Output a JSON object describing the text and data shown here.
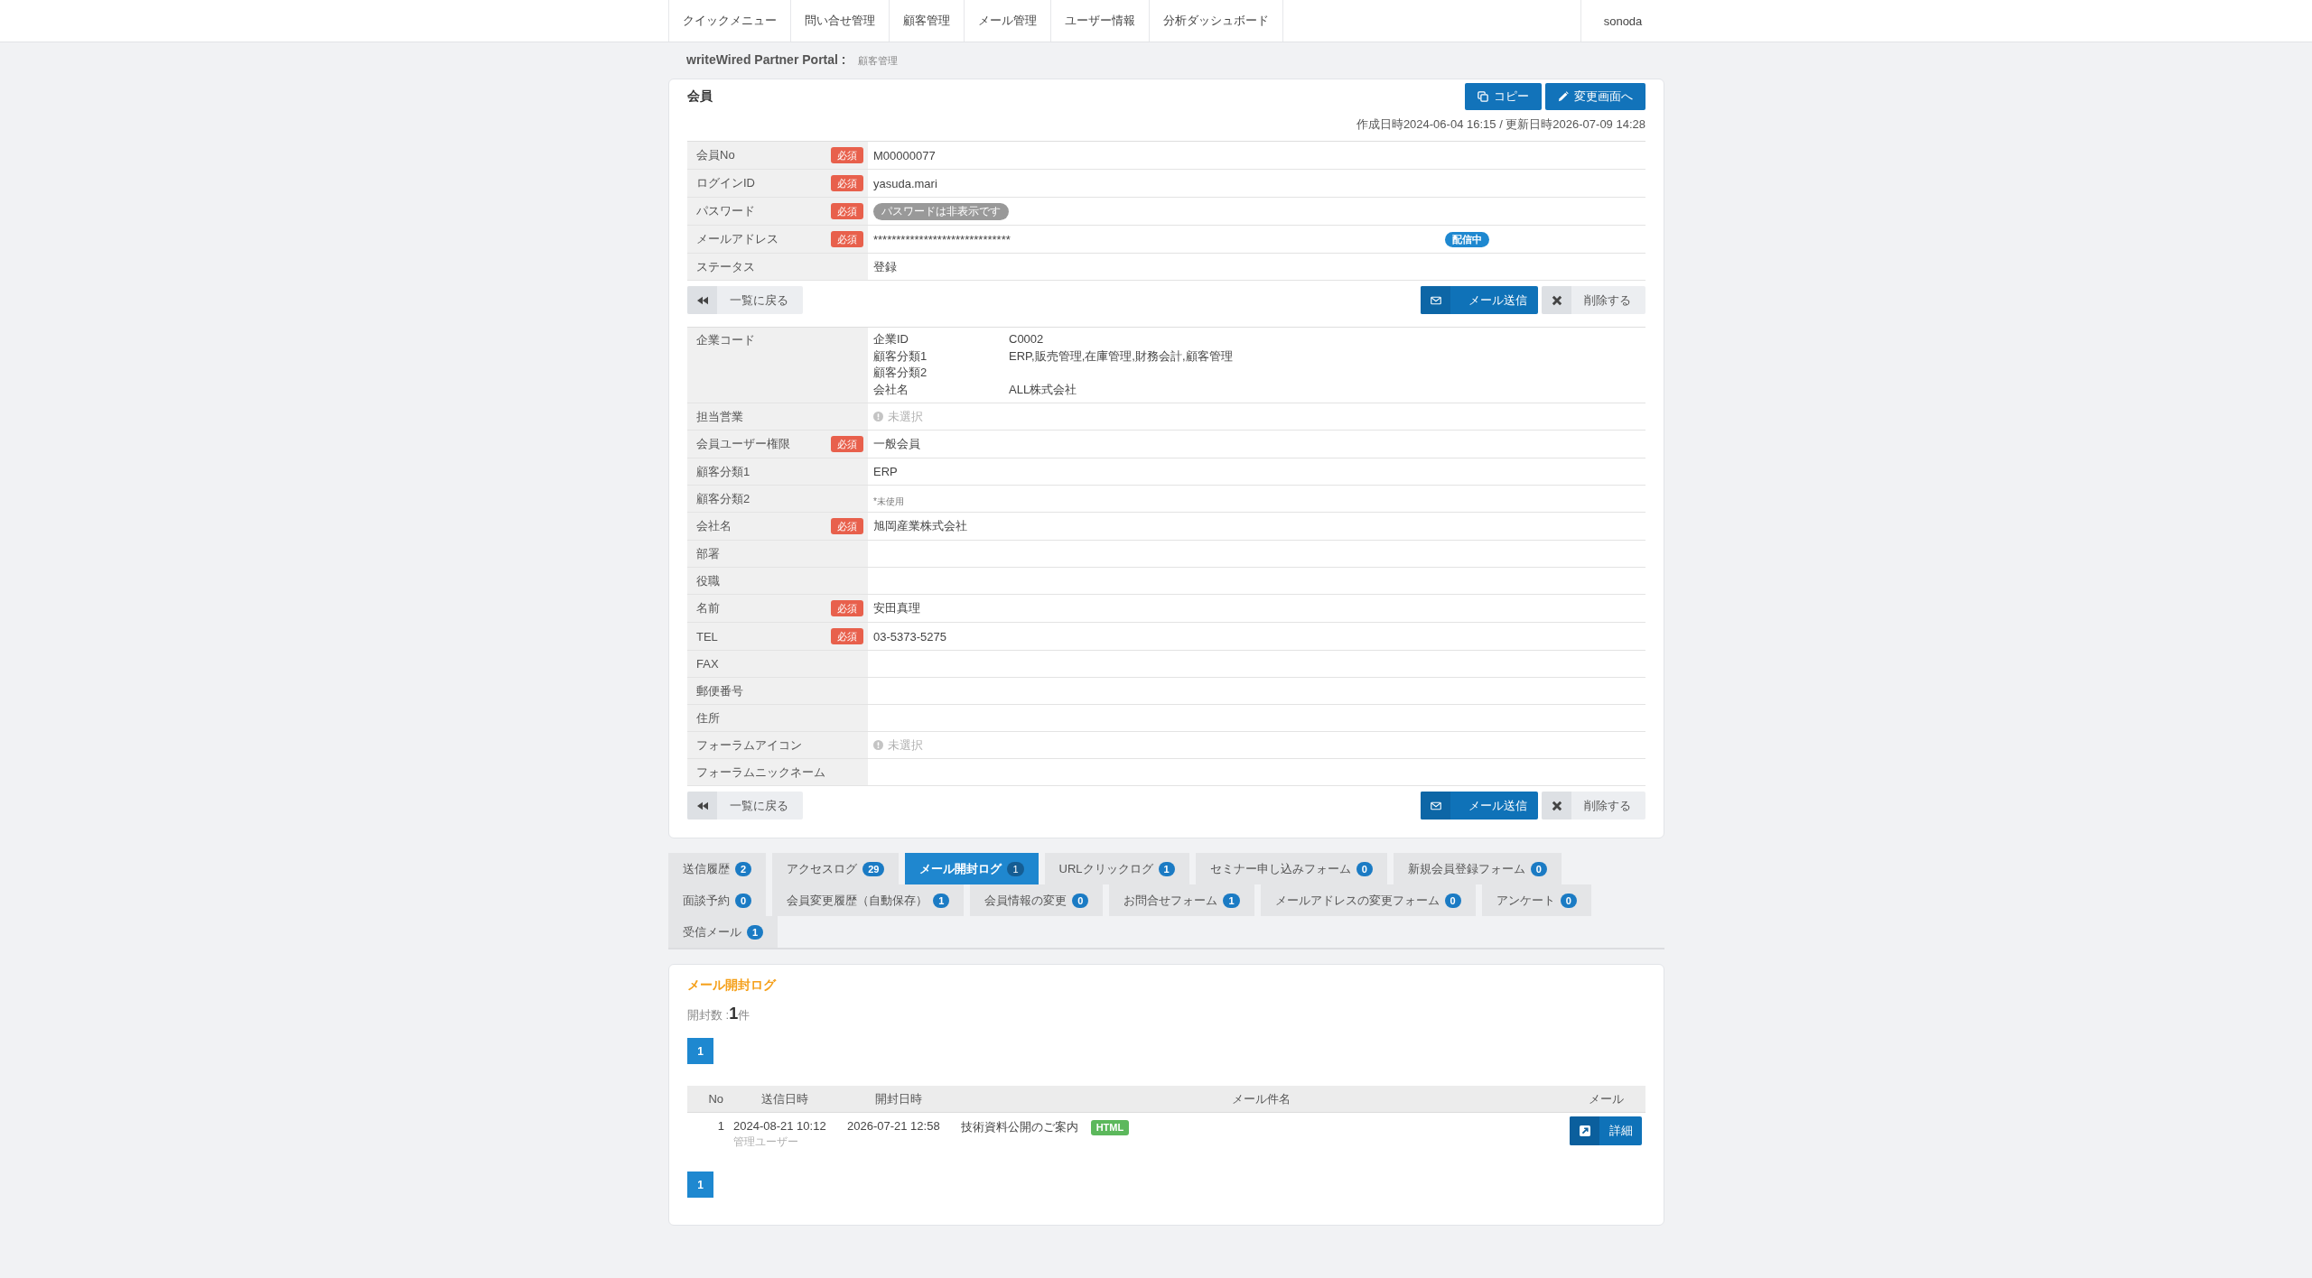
{
  "nav": {
    "items": [
      "クイックメニュー",
      "問い合せ管理",
      "顧客管理",
      "メール管理",
      "ユーザー情報",
      "分析ダッシュボード"
    ],
    "user": "sonoda"
  },
  "breadcrumb": {
    "portal": "writeWired Partner Portal :",
    "page": "顧客管理"
  },
  "member": {
    "title": "会員",
    "header_buttons": [
      {
        "kind": "copy",
        "label": "コピー"
      },
      {
        "kind": "edit",
        "label": "変更画面へ"
      }
    ],
    "timestamps": "作成日時2024-06-04 16:15 / 更新日時2026-07-09 14:28",
    "account_fields": [
      {
        "label": "会員No",
        "required_badge": "必須",
        "kind": "text",
        "value": "M00000077"
      },
      {
        "label": "ログインID",
        "required_badge": "必須",
        "kind": "text",
        "value": "yasuda.mari"
      },
      {
        "label": "パスワード",
        "required_badge": "必須",
        "kind": "pill",
        "value": "パスワードは非表示です"
      },
      {
        "label": "メールアドレス",
        "required_badge": "必須",
        "kind": "text",
        "value": "******************************",
        "status_badge": "配信中"
      },
      {
        "label": "ステータス",
        "kind": "text",
        "value": "登録"
      }
    ],
    "actions_top": [
      {
        "kind": "back",
        "label": "一覧に戻る"
      },
      {
        "kind": "mail",
        "label": "メール送信"
      },
      {
        "kind": "delete",
        "label": "削除する"
      }
    ],
    "profile_fields": [
      {
        "label": "企業コード",
        "kind": "details",
        "details": [
          {
            "key": "企業ID",
            "value": "C0002"
          },
          {
            "key": "顧客分類1",
            "value": "ERP,販売管理,在庫管理,財務会計,顧客管理"
          },
          {
            "key": "顧客分類2"
          },
          {
            "key": "会社名",
            "value": "ALL株式会社"
          }
        ]
      },
      {
        "label": "担当営業",
        "kind": "unselected",
        "value": "未選択"
      },
      {
        "label": "会員ユーザー権限",
        "required_badge": "必須",
        "kind": "text",
        "value": "一般会員"
      },
      {
        "label": "顧客分類1",
        "kind": "text",
        "value": "ERP"
      },
      {
        "label": "顧客分類2",
        "kind": "note",
        "value": "*未使用"
      },
      {
        "label": "会社名",
        "required_badge": "必須",
        "kind": "text",
        "value": "旭岡産業株式会社"
      },
      {
        "label": "部署",
        "kind": "text"
      },
      {
        "label": "役職",
        "kind": "text"
      },
      {
        "label": "名前",
        "required_badge": "必須",
        "kind": "text",
        "value": "安田真理"
      },
      {
        "label": "TEL",
        "required_badge": "必須",
        "kind": "text",
        "value": "03-5373-5275"
      },
      {
        "label": "FAX",
        "kind": "text"
      },
      {
        "label": "郵便番号",
        "kind": "text"
      },
      {
        "label": "住所",
        "kind": "text"
      },
      {
        "label": "フォーラムアイコン",
        "kind": "unselected",
        "value": "未選択"
      },
      {
        "label": "フォーラムニックネーム",
        "kind": "text"
      }
    ],
    "actions_bottom": [
      {
        "kind": "back",
        "label": "一覧に戻る"
      },
      {
        "kind": "mail",
        "label": "メール送信"
      },
      {
        "kind": "delete",
        "label": "削除する"
      }
    ]
  },
  "tab_rows": [
    [
      {
        "label": "送信履歴",
        "count": "2",
        "selected": false
      },
      {
        "label": "アクセスログ",
        "count": "29",
        "selected": false
      },
      {
        "label": "メール開封ログ",
        "count": "1",
        "selected": true
      },
      {
        "label": "URLクリックログ",
        "count": "1",
        "selected": false
      },
      {
        "label": "セミナー申し込みフォーム",
        "count": "0",
        "selected": false
      },
      {
        "label": "新規会員登録フォーム",
        "count": "0",
        "selected": false
      }
    ],
    [
      {
        "label": "面談予約",
        "count": "0",
        "selected": false
      },
      {
        "label": "会員変更履歴（自動保存）",
        "count": "1",
        "selected": false
      },
      {
        "label": "会員情報の変更",
        "count": "0",
        "selected": false
      },
      {
        "label": "お問合せフォーム",
        "count": "1",
        "selected": false
      },
      {
        "label": "メールアドレスの変更フォーム",
        "count": "0",
        "selected": false
      },
      {
        "label": "アンケート",
        "count": "0",
        "selected": false
      }
    ],
    [
      {
        "label": "受信メール",
        "count": "1",
        "selected": false
      }
    ]
  ],
  "log_panel": {
    "title": "メール開封ログ",
    "count_text": "開封数 :**1**件",
    "pagination_top": [
      {
        "label": "1",
        "selected": true
      }
    ],
    "columns": [
      "No",
      "送信日時",
      "開封日時",
      "メール件名",
      "メール"
    ],
    "rows": [
      {
        "no": "1",
        "sent_at": "2024-08-21 10:12",
        "sender": "管理ユーザー",
        "opened_at": "2026-07-21 12:58",
        "subject": "技術資料公開のご案内",
        "format_badge": "HTML",
        "action": "詳細"
      }
    ],
    "pagination_bottom": [
      {
        "label": "1",
        "selected": true
      }
    ]
  }
}
